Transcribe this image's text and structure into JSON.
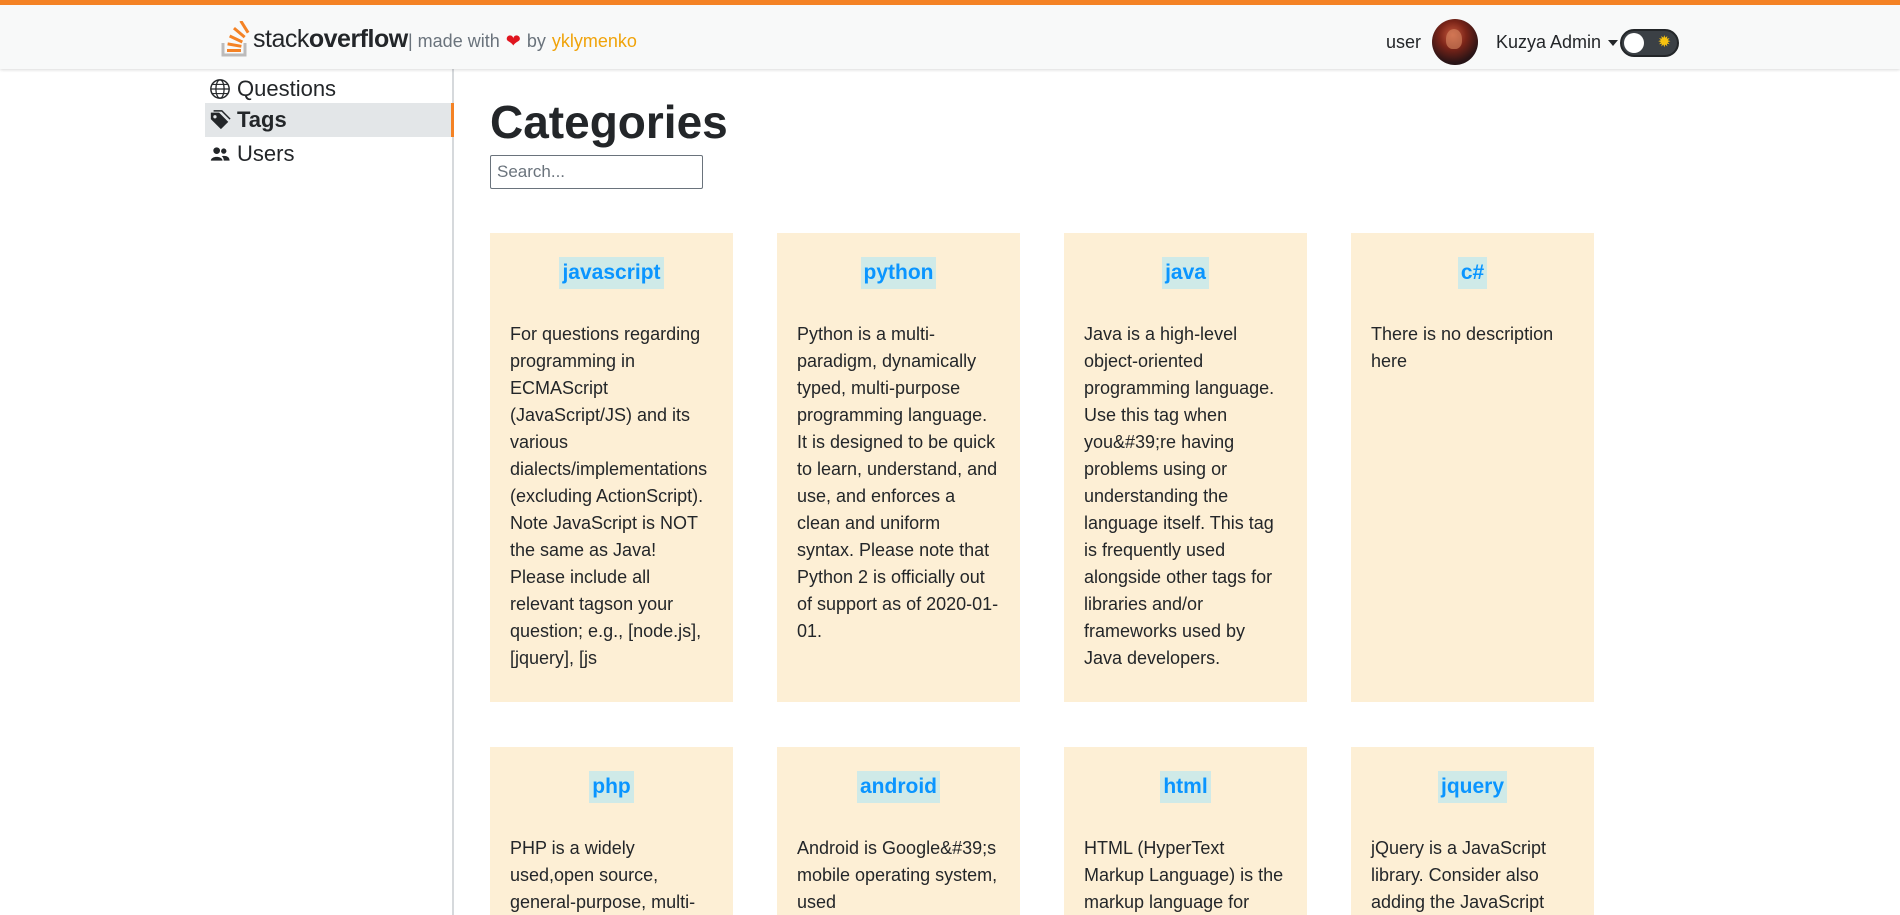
{
  "header": {
    "logo_text_light": "stack",
    "logo_text_bold": "overflow",
    "made_with_prefix": "| made with",
    "made_with_by": "by",
    "author": "yklymenko",
    "user_label": "user",
    "admin_name": "Kuzya Admin"
  },
  "sidebar": {
    "items": [
      {
        "label": "Questions",
        "icon": "globe-icon",
        "active": false
      },
      {
        "label": "Tags",
        "icon": "tag-icon",
        "active": true
      },
      {
        "label": "Users",
        "icon": "users-icon",
        "active": false
      }
    ]
  },
  "main": {
    "title": "Categories",
    "search_placeholder": "Search...",
    "categories": [
      {
        "name": "javascript",
        "description": "For questions regarding programming in ECMAScript (JavaScript/JS) and its various dialects/implementations (excluding ActionScript). Note JavaScript is NOT the same as Java! Please include all relevant tagson your question; e.g., [node.js], [jquery], [js"
      },
      {
        "name": "python",
        "description": "Python is a multi-paradigm, dynamically typed, multi-purpose programming language. It is designed to be quick to learn, understand, and use, and enforces a clean and uniform syntax. Please note that Python 2 is officially out of support as of 2020-01-01."
      },
      {
        "name": "java",
        "description": "Java is a high-level object-oriented programming language. Use this tag when you&#39;re having problems using or understanding the language itself. This tag is frequently used alongside other tags for libraries and/or frameworks used by Java developers."
      },
      {
        "name": "c#",
        "description": "There is no description here"
      },
      {
        "name": "php",
        "description": "PHP is a widely used,open source, general-purpose, multi-"
      },
      {
        "name": "android",
        "description": "Android is Google&#39;s mobile operating system, used"
      },
      {
        "name": "html",
        "description": "HTML (HyperText Markup Language) is the markup language for"
      },
      {
        "name": "jquery",
        "description": "jQuery is a JavaScript library. Consider also adding the JavaScript"
      }
    ]
  },
  "colors": {
    "accent": "#f48225",
    "tag_text": "#0a95ff",
    "tag_bg": "#cfeae8",
    "card_bg": "#fdefd5",
    "author": "#f0a30a"
  }
}
